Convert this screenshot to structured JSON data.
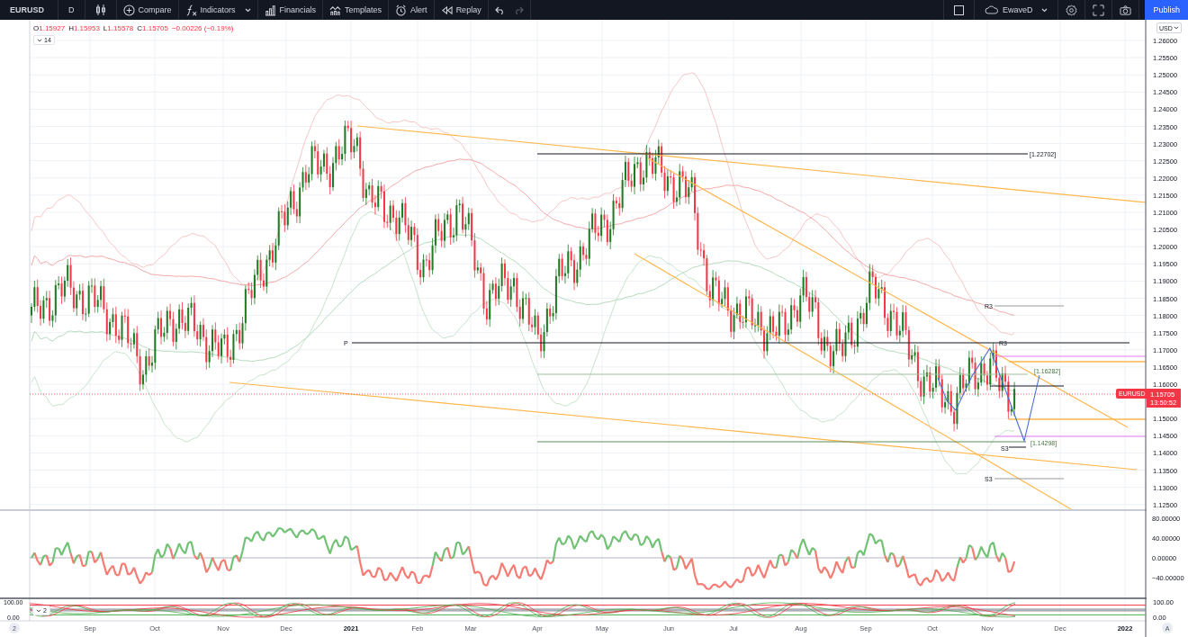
{
  "toolbar": {
    "symbol": "EURUSD",
    "interval": "D",
    "tools": [
      {
        "label": "Compare",
        "dropdown": false
      },
      {
        "label": "Indicators",
        "dropdown": true
      },
      {
        "label": "Financials",
        "dropdown": false
      },
      {
        "label": "Templates",
        "dropdown": false
      },
      {
        "label": "Alert",
        "dropdown": false
      },
      {
        "label": "Replay",
        "dropdown": false
      }
    ],
    "undo": {
      "disabled": false
    },
    "redo": {
      "disabled": true
    },
    "layout_name": "EwaveD",
    "publish": "Publish"
  },
  "legend": {
    "values": [
      {
        "key": "O",
        "value": "1.15927"
      },
      {
        "key": "H",
        "value": "1.15953"
      },
      {
        "key": "L",
        "value": "1.15578"
      },
      {
        "key": "C",
        "value": "1.15705"
      }
    ],
    "change": "−0.00226 (−0.19%)",
    "indicators_toggle": "14"
  },
  "price_axis": {
    "currency": "USD",
    "ticks": [
      "1.26000",
      "1.25500",
      "1.25000",
      "1.24500",
      "1.24000",
      "1.23500",
      "1.23000",
      "1.22500",
      "1.22000",
      "1.21500",
      "1.21000",
      "1.20500",
      "1.20000",
      "1.19500",
      "1.19000",
      "1.18500",
      "1.18000",
      "1.17500",
      "1.17000",
      "1.16500",
      "1.16000",
      "1.15000",
      "1.14500",
      "1.14000",
      "1.13500",
      "1.13000",
      "1.12500"
    ],
    "last_price": "1.15705",
    "countdown": "13:50:52",
    "symbol_label": "EURUSD"
  },
  "annotations": [
    "P",
    "[1.22702]",
    "R3",
    "R3",
    "[1.16282]",
    "[1.14298]",
    "S3",
    "S3"
  ],
  "oscillator_axis": {
    "ticks": [
      "80.00000",
      "40.00000",
      "0.00000",
      "−40.00000"
    ]
  },
  "stochastic": {
    "toggle": "2",
    "ticks": [
      "100.00",
      "0.00"
    ],
    "left_ticks": [
      "100.00",
      "0.00"
    ]
  },
  "time_axis": {
    "pane_badge": "2",
    "labels": [
      "Sep",
      "Oct",
      "Nov",
      "Dec",
      "2021",
      "Feb",
      "Mar",
      "Apr",
      "May",
      "Jun",
      "Jul",
      "Aug",
      "Sep",
      "Oct",
      "Nov",
      "Dec",
      "2022"
    ],
    "auto_scale": "A"
  }
}
